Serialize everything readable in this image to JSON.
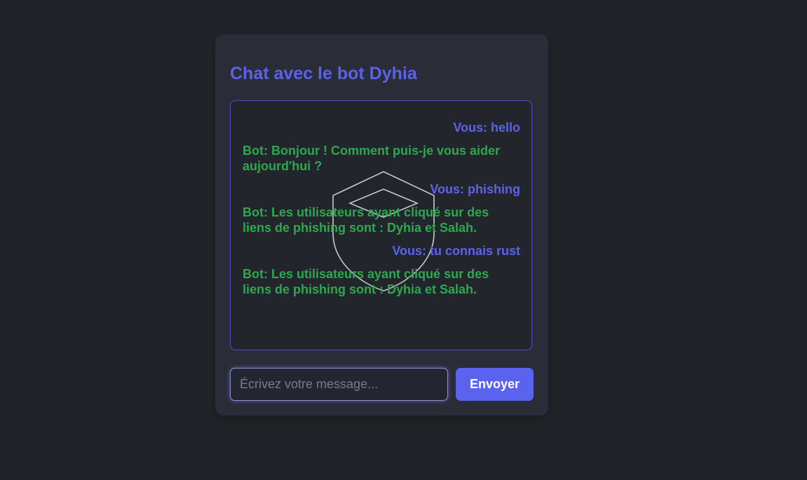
{
  "title": "Chat avec le bot Dyhia",
  "messages": [
    {
      "sender": "user",
      "text": "Vous: hello"
    },
    {
      "sender": "bot",
      "text": "Bot: Bonjour ! Comment puis-je vous aider aujourd'hui ?"
    },
    {
      "sender": "user",
      "text": "Vous: phishing"
    },
    {
      "sender": "bot",
      "text": "Bot: Les utilisateurs ayant cliqué sur des liens de phishing sont : Dyhia et Salah."
    },
    {
      "sender": "user",
      "text": "Vous: tu connais rust"
    },
    {
      "sender": "bot",
      "text": "Bot: Les utilisateurs ayant cliqué sur des liens de phishing sont : Dyhia et Salah."
    }
  ],
  "input": {
    "placeholder": "Écrivez votre message...",
    "value": ""
  },
  "send_label": "Envoyer",
  "colors": {
    "accent": "#5a63ee",
    "bot_text": "#2ea84f",
    "user_text": "#5b63e8",
    "background": "#212329",
    "card": "#2a2d38"
  },
  "watermark_icon": "shield-icon"
}
